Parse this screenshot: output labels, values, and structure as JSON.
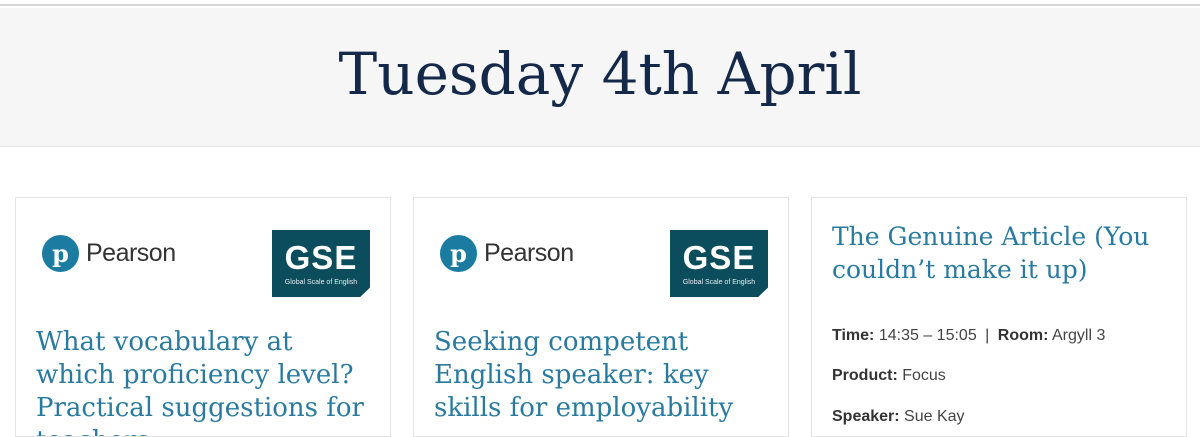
{
  "header": {
    "date": "Tuesday 4th April"
  },
  "cards": [
    {
      "pearson_text": "Pearson",
      "gse_text": "GSE",
      "gse_sub": "Global Scale of English",
      "title": "What vocabulary at which proficiency level? Practical suggestions for teachers"
    },
    {
      "pearson_text": "Pearson",
      "gse_text": "GSE",
      "gse_sub": "Global Scale of English",
      "title": "Seeking competent English speaker: key skills for employability"
    },
    {
      "title": "The Genuine Article (You couldn’t make it up)",
      "time_label": "Time:",
      "time_value": "14:35 – 15:05",
      "room_label": "Room:",
      "room_value": "Argyll 3",
      "separator": "|",
      "product_label": "Product:",
      "product_value": "Focus",
      "speaker_label": "Speaker:",
      "speaker_value": "Sue Kay"
    }
  ]
}
